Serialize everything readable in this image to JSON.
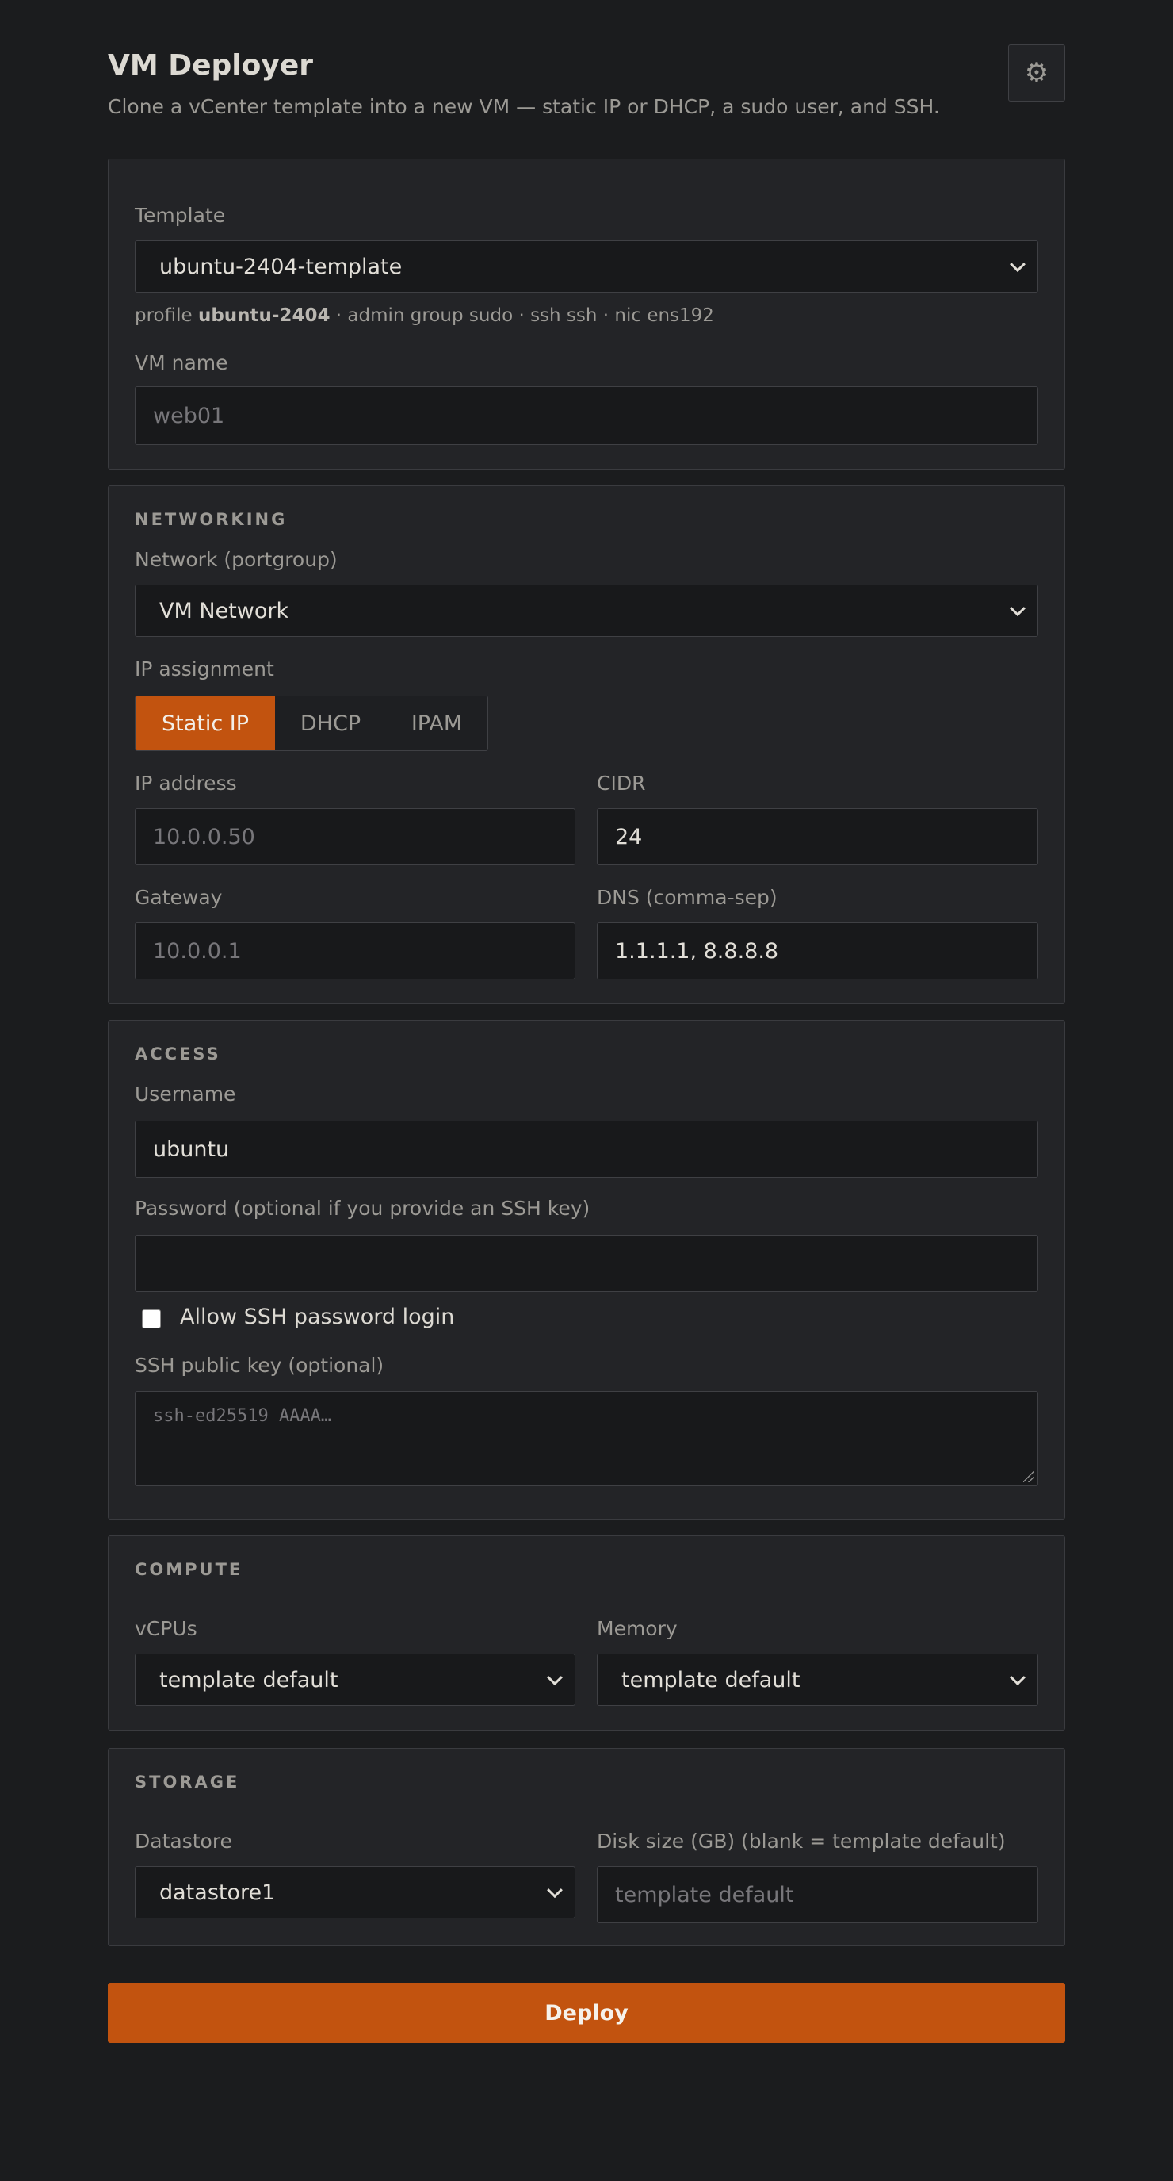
{
  "header": {
    "title": "VM Deployer",
    "subtitle": "Clone a vCenter template into a new VM — static IP or DHCP, a sudo user, and SSH.",
    "settings_icon": "gear-icon"
  },
  "template_panel": {
    "template_label": "Template",
    "template_value": "ubuntu-2404-template",
    "hint_prefix": "profile",
    "hint_profile": "ubuntu-2404",
    "hint_rest": "· admin group sudo · ssh ssh · nic ens192",
    "vm_name_label": "VM name",
    "vm_name_placeholder": "web01"
  },
  "networking": {
    "title": "NETWORKING",
    "network_label": "Network (portgroup)",
    "network_value": "VM Network",
    "ip_assignment_label": "IP assignment",
    "ip_modes": [
      "Static IP",
      "DHCP",
      "IPAM"
    ],
    "selected_mode": "Static IP",
    "ip_label": "IP address",
    "ip_placeholder": "10.0.0.50",
    "cidr_label": "CIDR",
    "cidr_value": "24",
    "gateway_label": "Gateway",
    "gateway_placeholder": "10.0.0.1",
    "dns_label": "DNS (comma-sep)",
    "dns_value": "1.1.1.1, 8.8.8.8"
  },
  "access": {
    "title": "ACCESS",
    "username_label": "Username",
    "username_value": "ubuntu",
    "password_label": "Password (optional if you provide an SSH key)",
    "password_value": "",
    "allow_ssh_label": "Allow SSH password login",
    "allow_ssh_checked": false,
    "ssh_key_label": "SSH public key (optional)",
    "ssh_key_placeholder": "ssh-ed25519 AAAA…"
  },
  "compute": {
    "title": "COMPUTE",
    "vcpus_label": "vCPUs",
    "vcpus_value": "template default",
    "memory_label": "Memory",
    "memory_value": "template default"
  },
  "storage": {
    "title": "STORAGE",
    "datastore_label": "Datastore",
    "datastore_value": "datastore1",
    "disk_label": "Disk size (GB) (blank = template default)",
    "disk_placeholder": "template default"
  },
  "actions": {
    "deploy_label": "Deploy"
  },
  "colors": {
    "accent": "#c2530f",
    "background": "#1b1c1e",
    "panel": "#232427"
  }
}
